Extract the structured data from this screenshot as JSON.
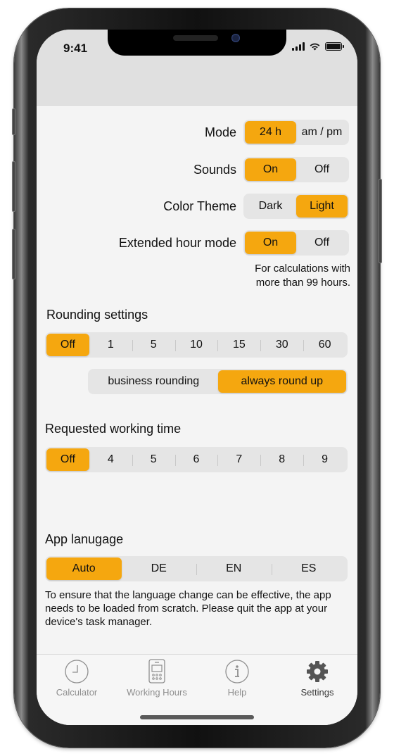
{
  "status_bar": {
    "time": "9:41"
  },
  "accent_color": "#f5a70f",
  "settings": {
    "mode": {
      "label": "Mode",
      "options": [
        "24 h",
        "am / pm"
      ],
      "selected": "24 h"
    },
    "sounds": {
      "label": "Sounds",
      "options": [
        "On",
        "Off"
      ],
      "selected": "On"
    },
    "color_theme": {
      "label": "Color Theme",
      "options": [
        "Dark",
        "Light"
      ],
      "selected": "Light"
    },
    "extended_hour_mode": {
      "label": "Extended hour mode",
      "options": [
        "On",
        "Off"
      ],
      "selected": "On",
      "note_line1": "For calculations with",
      "note_line2": "more than 99 hours."
    }
  },
  "rounding": {
    "title": "Rounding settings",
    "options": [
      "Off",
      "1",
      "5",
      "10",
      "15",
      "30",
      "60"
    ],
    "selected": "Off",
    "mode_options": [
      "business rounding",
      "always round up"
    ],
    "mode_selected": "always round up"
  },
  "working_time": {
    "title": "Requested working time",
    "options": [
      "Off",
      "4",
      "5",
      "6",
      "7",
      "8",
      "9"
    ],
    "selected": "Off"
  },
  "language": {
    "title": "App lanugage",
    "options": [
      "Auto",
      "DE",
      "EN",
      "ES"
    ],
    "selected": "Auto",
    "note": "To ensure that the language change can be effective, the app needs to be loaded from scratch. Please quit the app at your device's task manager."
  },
  "tabbar": {
    "items": [
      {
        "label": "Calculator",
        "icon": "clock-icon",
        "active": false
      },
      {
        "label": "Working Hours",
        "icon": "calculator-device-icon",
        "active": false
      },
      {
        "label": "Help",
        "icon": "info-icon",
        "active": false
      },
      {
        "label": "Settings",
        "icon": "gear-icon",
        "active": true
      }
    ]
  }
}
